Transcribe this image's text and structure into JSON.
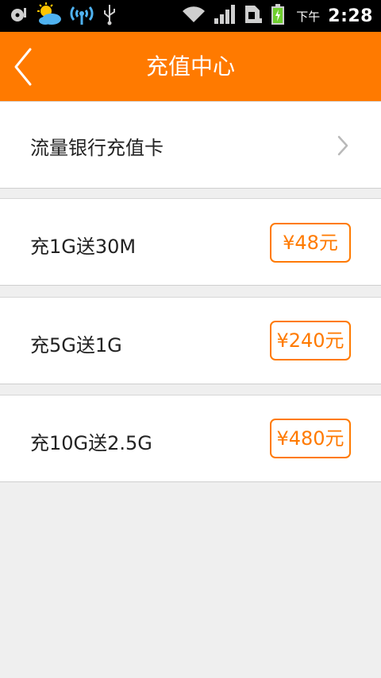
{
  "status_bar": {
    "time_prefix": "下午",
    "time": "2:28",
    "icons": [
      "media-icon",
      "weather-icon",
      "hotspot-icon",
      "usb-icon",
      "wifi-icon",
      "signal-icon",
      "sim-icon",
      "battery-icon"
    ]
  },
  "header": {
    "title": "充值中心",
    "back_icon": "back-chevron-icon"
  },
  "bank_card": {
    "label": "流量银行充值卡"
  },
  "packages": [
    {
      "label": "充1G送30M",
      "price": "¥48元"
    },
    {
      "label": "充5G送1G",
      "price": "¥240元"
    },
    {
      "label": "充10G送2.5G",
      "price": "¥480元"
    }
  ],
  "colors": {
    "accent": "#ff7a00",
    "background": "#efefef",
    "card": "#ffffff",
    "text": "#222222"
  }
}
